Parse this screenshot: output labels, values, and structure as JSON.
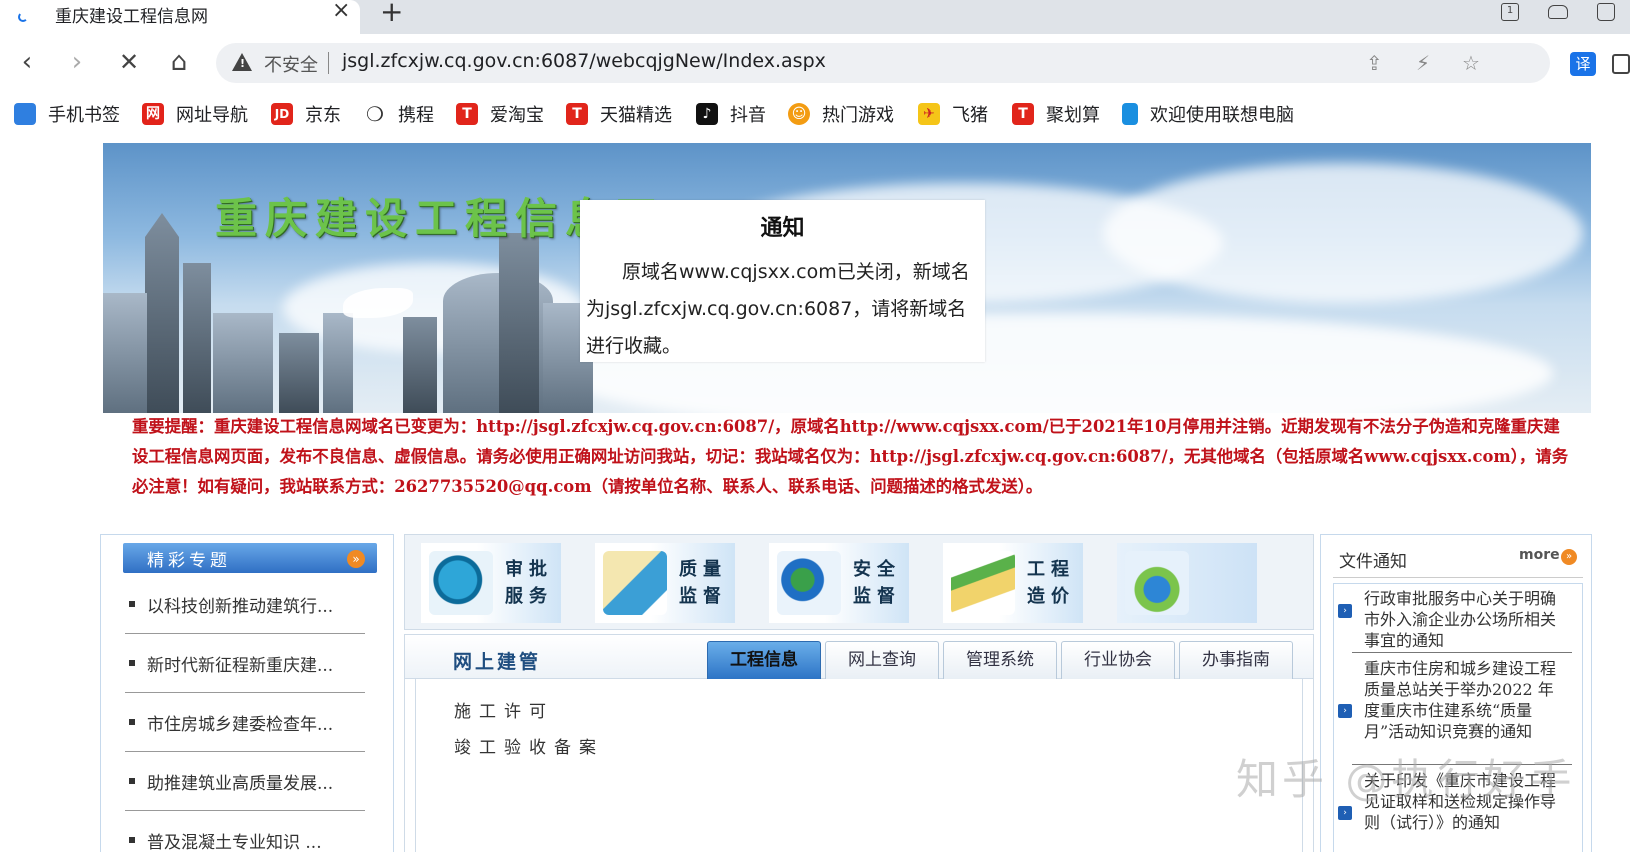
{
  "browser": {
    "tab_title": "重庆建设工程信息网",
    "tab_close": "×",
    "new_tab": "+",
    "insecure_label": "不安全",
    "url": "jsgl.zfcxjw.cq.gov.cn:6087/webcqjgNew/Index.aspx",
    "window_box_label": "1",
    "translate_label": "译"
  },
  "bookmarks": [
    {
      "label": "手机书签",
      "icon": "phone-bookmark-icon",
      "color": "#2f7fe0"
    },
    {
      "label": "网址导航",
      "icon": "navigation-icon",
      "color": "#e2231a"
    },
    {
      "label": "京东",
      "icon": "jd-icon",
      "color": "#e1251b"
    },
    {
      "label": "携程",
      "icon": "ctrip-icon",
      "color": "#333333"
    },
    {
      "label": "爱淘宝",
      "icon": "taobao-icon",
      "color": "#e1251b"
    },
    {
      "label": "天猫精选",
      "icon": "tmall-icon",
      "color": "#e1251b"
    },
    {
      "label": "抖音",
      "icon": "douyin-icon",
      "color": "#111111"
    },
    {
      "label": "热门游戏",
      "icon": "game-icon",
      "color": "#f39c12"
    },
    {
      "label": "飞猪",
      "icon": "fliggy-icon",
      "color": "#f5c518"
    },
    {
      "label": "聚划算",
      "icon": "juhuasuan-icon",
      "color": "#e1251b"
    },
    {
      "label": "欢迎使用联想电脑",
      "icon": "lenovo-icon",
      "color": "#1a8fe0"
    }
  ],
  "banner": {
    "site_title": "重庆建设工程信息网"
  },
  "notice": {
    "title": "通知",
    "body": "原域名www.cqjsxx.com已关闭，新域名为jsgl.zfcxjw.cq.gov.cn:6087，请将新域名进行收藏。"
  },
  "alert": {
    "text": "重要提醒：重庆建设工程信息网域名已变更为：http://jsgl.zfcxjw.cq.gov.cn:6087/，原域名http://www.cqjsxx.com/已于2021年10月停用并注销。近期发现有不法分子伪造和克隆重庆建设工程信息网页面，发布不良信息、虚假信息。请务必使用正确网址访问我站，切记：我站域名仅为：http://jsgl.zfcxjw.cq.gov.cn:6087/，无其他域名（包括原域名www.cqjsxx.com），请务必注意！如有疑问，我站联系方式：2627735520@qq.com（请按单位名称、联系人、联系电话、问题描述的格式发送）。"
  },
  "left": {
    "title": "精彩专题",
    "items": [
      "以科技创新推动建筑行...",
      "新时代新征程新重庆建...",
      "市住房城乡建委检查年...",
      "助推建筑业高质量发展...",
      "普及混凝土专业知识 ..."
    ]
  },
  "quick_links": [
    {
      "label": "审批服务",
      "icon": "approval-service-icon"
    },
    {
      "label": "质量监督",
      "icon": "quality-supervision-icon"
    },
    {
      "label": "安全监督",
      "icon": "safety-supervision-icon"
    },
    {
      "label": "工程造价",
      "icon": "engineering-cost-icon"
    },
    {
      "label": "",
      "icon": "download-icon"
    }
  ],
  "online": {
    "title": "网上建管",
    "tabs": [
      "工程信息",
      "网上查询",
      "管理系统",
      "行业协会",
      "办事指南"
    ],
    "active_tab": 0,
    "links": [
      "施工许可",
      "竣工验收备案"
    ]
  },
  "docs": {
    "title": "文件通知",
    "more": "more",
    "items": [
      "行政审批服务中心关于明确市外入渝企业办公场所相关事宜的通知",
      "重庆市住房和城乡建设工程质量总站关于举办2022 年度重庆市住建系统“质量月”活动知识竞赛的通知",
      "关于印发《重庆市建设工程见证取样和送检规定操作导则（试行）》的通知"
    ]
  },
  "watermark": "知乎 @执行好手"
}
